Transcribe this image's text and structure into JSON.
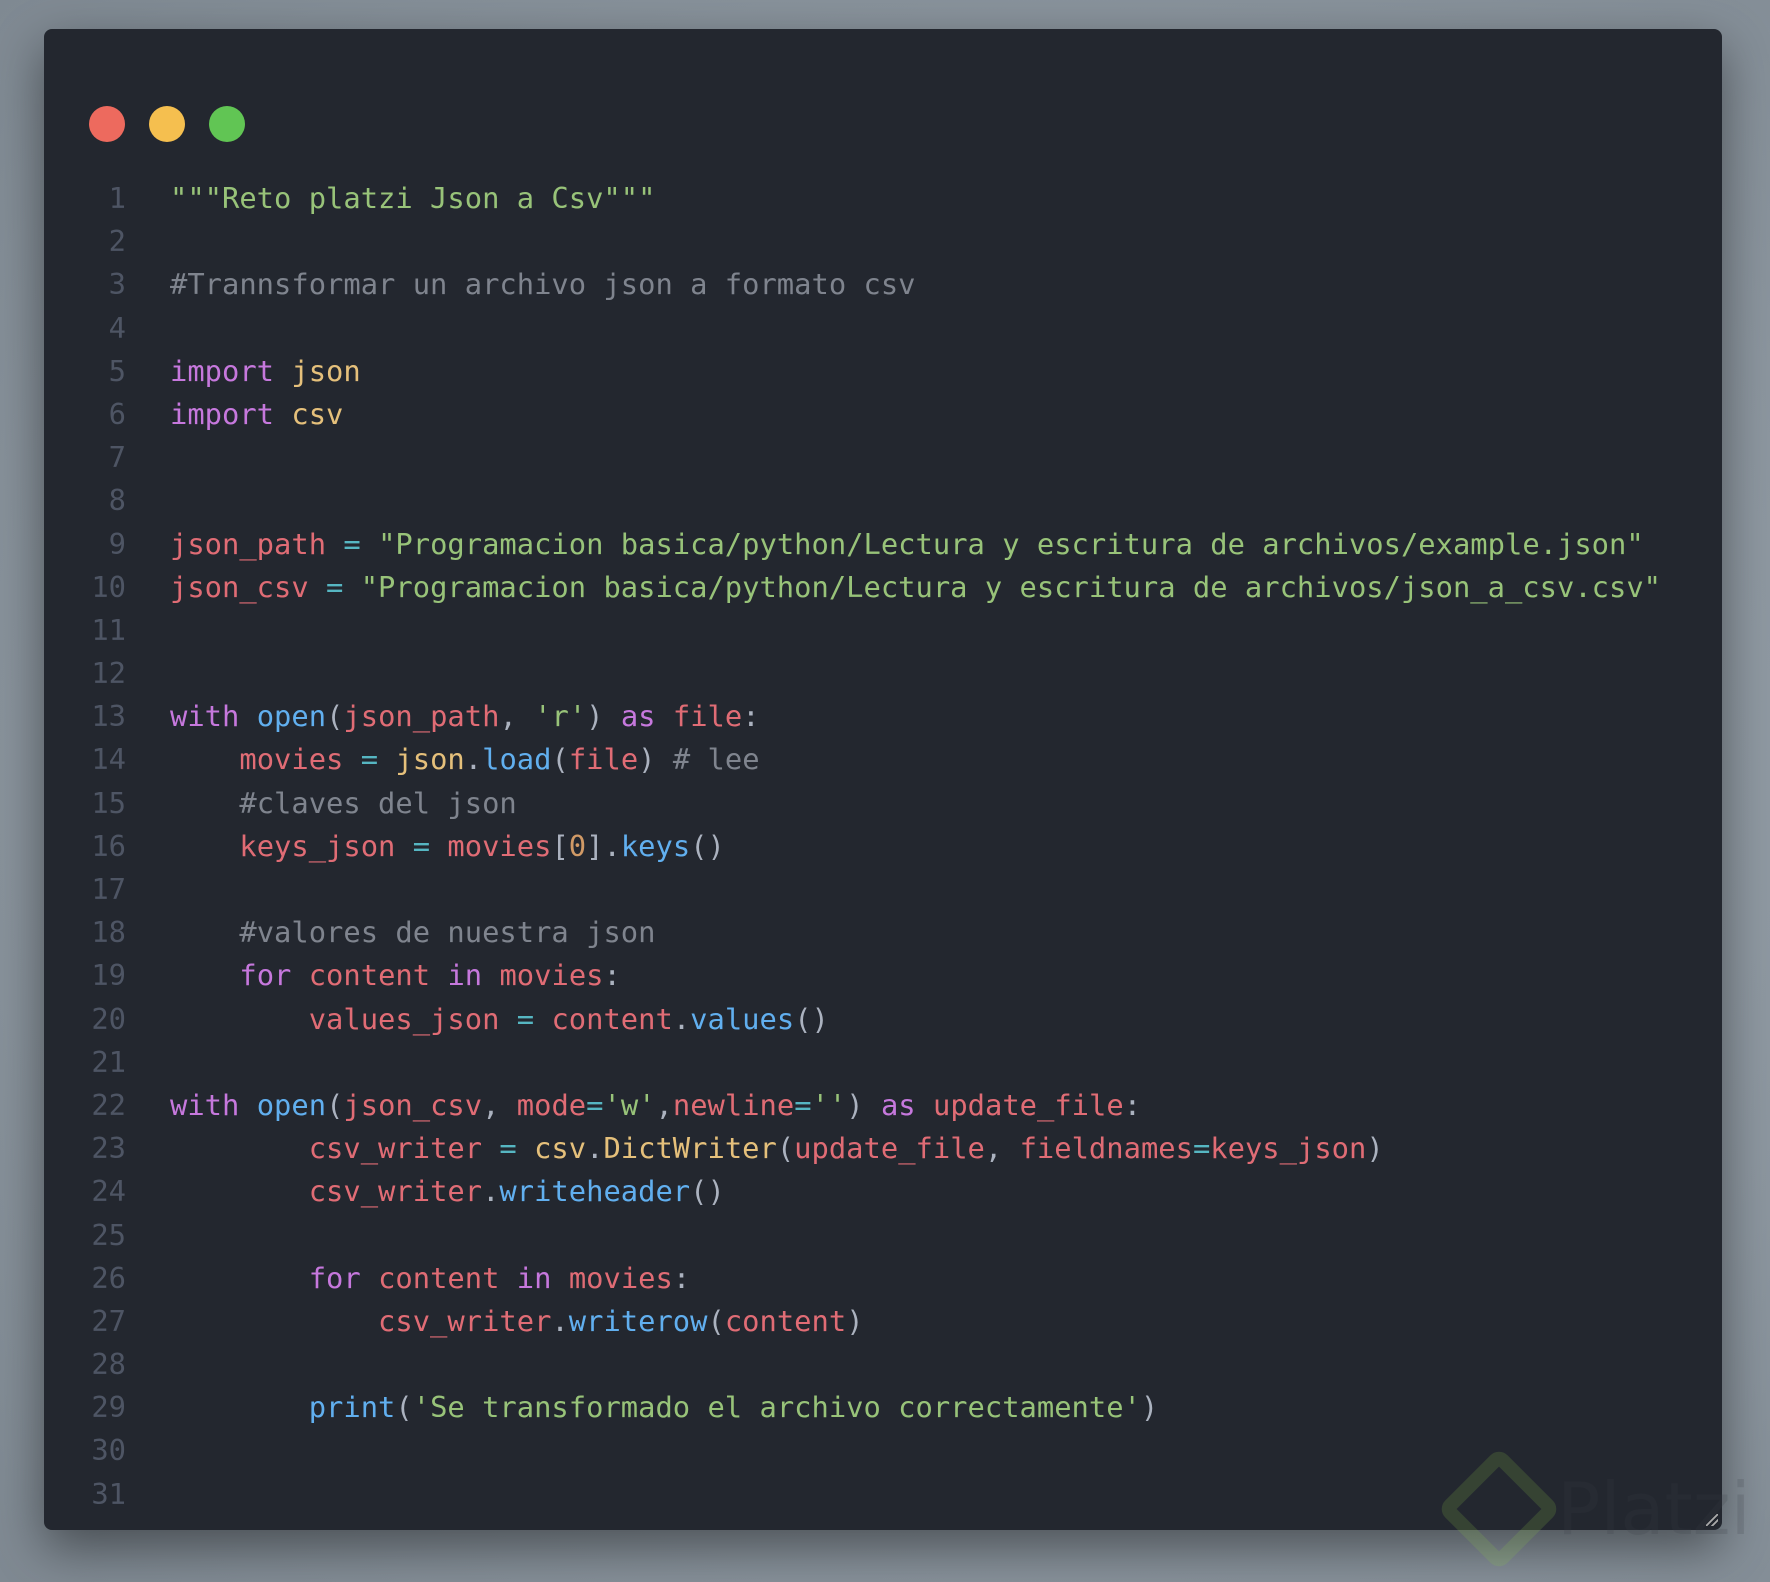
{
  "window": {
    "buttons": [
      {
        "name": "close",
        "color": "#ed6a5e"
      },
      {
        "name": "minimize",
        "color": "#f5bf4f"
      },
      {
        "name": "maximize",
        "color": "#61c554"
      }
    ]
  },
  "watermark": {
    "text": "Platzi"
  },
  "code": {
    "lines": [
      [
        [
          "str",
          "\"\"\"Reto platzi Json a Csv\"\"\""
        ]
      ],
      [],
      [
        [
          "cm",
          "#Trannsformar un archivo json a formato csv"
        ]
      ],
      [],
      [
        [
          "kw",
          "import"
        ],
        [
          "sp",
          " "
        ],
        [
          "mod",
          "json"
        ]
      ],
      [
        [
          "kw",
          "import"
        ],
        [
          "sp",
          " "
        ],
        [
          "mod",
          "csv"
        ]
      ],
      [],
      [],
      [
        [
          "var",
          "json_path"
        ],
        [
          "op",
          " = "
        ],
        [
          "str",
          "\"Programacion basica/python/Lectura y escritura de archivos/example.json\""
        ]
      ],
      [
        [
          "var",
          "json_csv"
        ],
        [
          "op",
          " = "
        ],
        [
          "str",
          "\"Programacion basica/python/Lectura y escritura de archivos/json_a_csv.csv\""
        ]
      ],
      [],
      [],
      [
        [
          "kw",
          "with"
        ],
        [
          "sp",
          " "
        ],
        [
          "fn",
          "open"
        ],
        [
          "p",
          "("
        ],
        [
          "var",
          "json_path"
        ],
        [
          "p",
          ", "
        ],
        [
          "str",
          "'r'"
        ],
        [
          "p",
          ") "
        ],
        [
          "kw",
          "as"
        ],
        [
          "sp",
          " "
        ],
        [
          "var",
          "file"
        ],
        [
          "p",
          ":"
        ]
      ],
      [
        [
          "sp",
          "    "
        ],
        [
          "var",
          "movies"
        ],
        [
          "op",
          " = "
        ],
        [
          "mod",
          "json"
        ],
        [
          "p",
          "."
        ],
        [
          "fn",
          "load"
        ],
        [
          "p",
          "("
        ],
        [
          "var",
          "file"
        ],
        [
          "p",
          ") "
        ],
        [
          "cm",
          "# lee"
        ]
      ],
      [
        [
          "sp",
          "    "
        ],
        [
          "cm",
          "#claves del json"
        ]
      ],
      [
        [
          "sp",
          "    "
        ],
        [
          "var",
          "keys_json"
        ],
        [
          "op",
          " = "
        ],
        [
          "var",
          "movies"
        ],
        [
          "p",
          "["
        ],
        [
          "num",
          "0"
        ],
        [
          "p",
          "]."
        ],
        [
          "fn",
          "keys"
        ],
        [
          "p",
          "()"
        ]
      ],
      [],
      [
        [
          "sp",
          "    "
        ],
        [
          "cm",
          "#valores de nuestra json"
        ]
      ],
      [
        [
          "sp",
          "    "
        ],
        [
          "kw",
          "for"
        ],
        [
          "sp",
          " "
        ],
        [
          "var",
          "content"
        ],
        [
          "sp",
          " "
        ],
        [
          "kw",
          "in"
        ],
        [
          "sp",
          " "
        ],
        [
          "var",
          "movies"
        ],
        [
          "p",
          ":"
        ]
      ],
      [
        [
          "sp",
          "        "
        ],
        [
          "var",
          "values_json"
        ],
        [
          "op",
          " = "
        ],
        [
          "var",
          "content"
        ],
        [
          "p",
          "."
        ],
        [
          "fn",
          "values"
        ],
        [
          "p",
          "()"
        ]
      ],
      [],
      [
        [
          "kw",
          "with"
        ],
        [
          "sp",
          " "
        ],
        [
          "fn",
          "open"
        ],
        [
          "p",
          "("
        ],
        [
          "var",
          "json_csv"
        ],
        [
          "p",
          ", "
        ],
        [
          "var",
          "mode"
        ],
        [
          "op",
          "="
        ],
        [
          "str",
          "'w'"
        ],
        [
          "p",
          ","
        ],
        [
          "var",
          "newline"
        ],
        [
          "op",
          "="
        ],
        [
          "str",
          "''"
        ],
        [
          "p",
          ") "
        ],
        [
          "kw",
          "as"
        ],
        [
          "sp",
          " "
        ],
        [
          "var",
          "update_file"
        ],
        [
          "p",
          ":"
        ]
      ],
      [
        [
          "sp",
          "        "
        ],
        [
          "var",
          "csv_writer"
        ],
        [
          "op",
          " = "
        ],
        [
          "mod",
          "csv"
        ],
        [
          "p",
          "."
        ],
        [
          "mod",
          "DictWriter"
        ],
        [
          "p",
          "("
        ],
        [
          "var",
          "update_file"
        ],
        [
          "p",
          ", "
        ],
        [
          "var",
          "fieldnames"
        ],
        [
          "op",
          "="
        ],
        [
          "var",
          "keys_json"
        ],
        [
          "p",
          ")"
        ]
      ],
      [
        [
          "sp",
          "        "
        ],
        [
          "var",
          "csv_writer"
        ],
        [
          "p",
          "."
        ],
        [
          "fn",
          "writeheader"
        ],
        [
          "p",
          "()"
        ]
      ],
      [],
      [
        [
          "sp",
          "        "
        ],
        [
          "kw",
          "for"
        ],
        [
          "sp",
          " "
        ],
        [
          "var",
          "content"
        ],
        [
          "sp",
          " "
        ],
        [
          "kw",
          "in"
        ],
        [
          "sp",
          " "
        ],
        [
          "var",
          "movies"
        ],
        [
          "p",
          ":"
        ]
      ],
      [
        [
          "sp",
          "            "
        ],
        [
          "var",
          "csv_writer"
        ],
        [
          "p",
          "."
        ],
        [
          "fn",
          "writerow"
        ],
        [
          "p",
          "("
        ],
        [
          "var",
          "content"
        ],
        [
          "p",
          ")"
        ]
      ],
      [],
      [
        [
          "sp",
          "        "
        ],
        [
          "fn",
          "print"
        ],
        [
          "p",
          "("
        ],
        [
          "str",
          "'Se transformado el archivo correctamente'"
        ],
        [
          "p",
          ")"
        ]
      ],
      [],
      []
    ]
  }
}
